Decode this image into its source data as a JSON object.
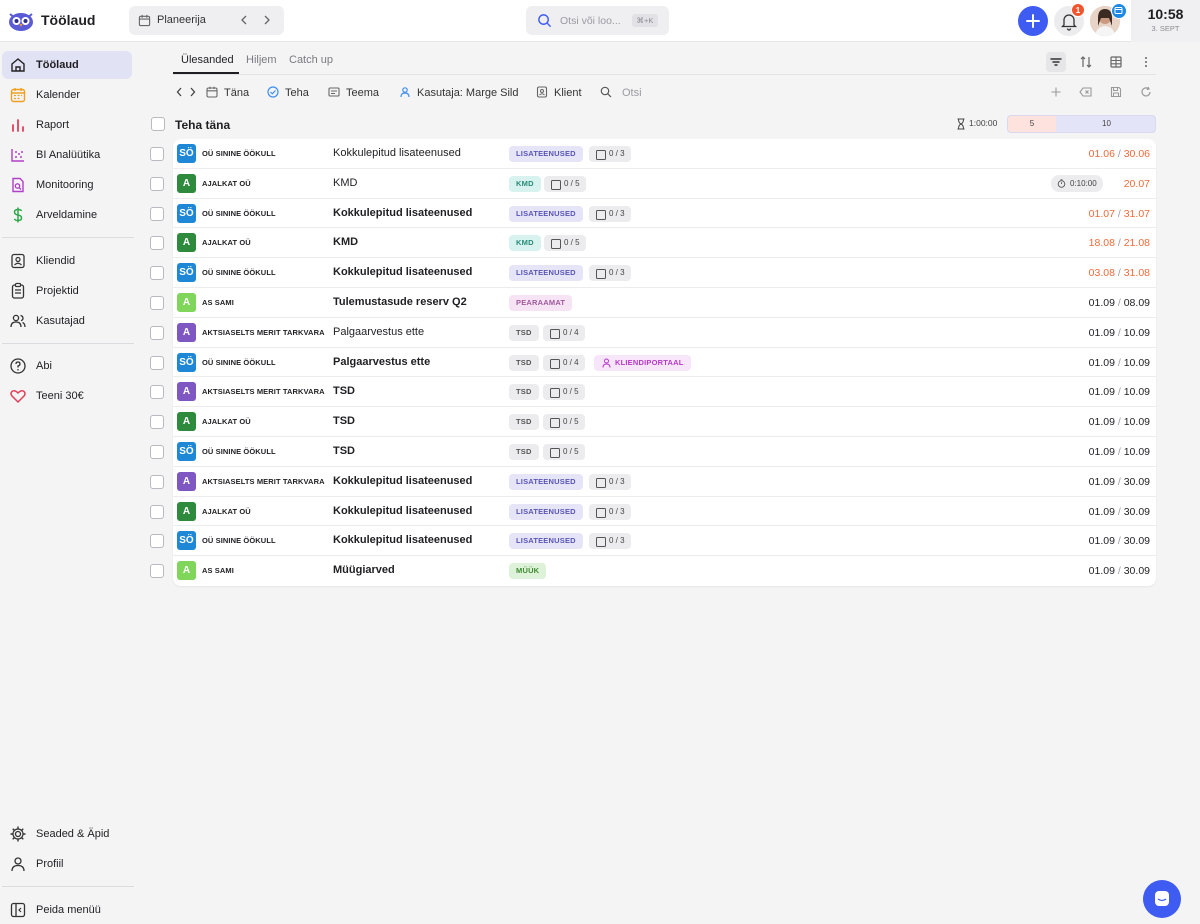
{
  "app": {
    "title": "Töölaud"
  },
  "topbar": {
    "planner_label": "Planeerija",
    "search_placeholder": "Otsi või loo...",
    "search_shortcut": "⌘+K",
    "notification_count": "1",
    "time": "10:58",
    "date": "3. SEPT"
  },
  "sidebar": {
    "items": [
      {
        "label": "Töölaud",
        "icon": "home-icon"
      },
      {
        "label": "Kalender",
        "icon": "calendar-icon"
      },
      {
        "label": "Raport",
        "icon": "bar-chart-icon"
      },
      {
        "label": "BI Analüütika",
        "icon": "scatter-chart-icon"
      },
      {
        "label": "Monitooring",
        "icon": "monitor-search-icon"
      },
      {
        "label": "Arveldamine",
        "icon": "dollar-icon"
      },
      {
        "label": "Kliendid",
        "icon": "contact-icon"
      },
      {
        "label": "Projektid",
        "icon": "clipboard-icon"
      },
      {
        "label": "Kasutajad",
        "icon": "users-icon"
      },
      {
        "label": "Abi",
        "icon": "help-icon"
      },
      {
        "label": "Teeni 30€",
        "icon": "heart-icon"
      },
      {
        "label": "Seaded & Äpid",
        "icon": "gear-icon"
      },
      {
        "label": "Profiil",
        "icon": "user-icon"
      },
      {
        "label": "Peida menüü",
        "icon": "sidebar-collapse-icon"
      }
    ]
  },
  "tabs": [
    {
      "label": "Ülesanded"
    },
    {
      "label": "Hiljem"
    },
    {
      "label": "Catch up"
    }
  ],
  "filters": {
    "date_label": "Täna",
    "status_label": "Teha",
    "topic_label": "Teema",
    "user_label": "Kasutaja: Marge Sild",
    "client_label": "Klient",
    "search_placeholder": "Otsi"
  },
  "section": {
    "title": "Teha täna",
    "time_total": "1:00:00",
    "capacity_low": "5",
    "capacity_high": "10"
  },
  "colors": {
    "accent": "#3e5bf2",
    "overdue": "#ef6a3a",
    "client_blue": "#1e88d6",
    "client_green": "#2e8b3e",
    "client_lightgreen": "#7fd65a",
    "client_purple": "#7e57c2"
  },
  "tasks": [
    {
      "avatar": "SÖ",
      "client": "OÜ SININE ÖÖKULL",
      "title": "Kokkulepitud lisateenused",
      "bold": false,
      "tag": "LISATEENUSED",
      "checklist": "0 / 3",
      "date_start": "01.06",
      "date_end": "30.06",
      "overdue": true
    },
    {
      "avatar": "A",
      "client": "AJALKAT OÜ",
      "title": "KMD",
      "bold": false,
      "tag": "KMD",
      "checklist": "0 / 5",
      "timer": "0:10:00",
      "date_start": "",
      "date_end": "20.07",
      "overdue": true
    },
    {
      "avatar": "SÖ",
      "client": "OÜ SININE ÖÖKULL",
      "title": "Kokkulepitud lisateenused",
      "bold": true,
      "tag": "LISATEENUSED",
      "checklist": "0 / 3",
      "date_start": "01.07",
      "date_end": "31.07",
      "overdue": true
    },
    {
      "avatar": "A",
      "client": "AJALKAT OÜ",
      "title": "KMD",
      "bold": true,
      "tag": "KMD",
      "checklist": "0 / 5",
      "date_start": "18.08",
      "date_end": "21.08",
      "overdue": true
    },
    {
      "avatar": "SÖ",
      "client": "OÜ SININE ÖÖKULL",
      "title": "Kokkulepitud lisateenused",
      "bold": true,
      "tag": "LISATEENUSED",
      "checklist": "0 / 3",
      "date_start": "03.08",
      "date_end": "31.08",
      "overdue": true
    },
    {
      "avatar": "A",
      "client": "AS SAMI",
      "title": "Tulemustasude reserv Q2",
      "bold": true,
      "tag": "PEARAAMAT",
      "date_start": "01.09",
      "date_end": "08.09",
      "overdue": false
    },
    {
      "avatar": "A",
      "client": "AKTSIASELTS MERIT TARKVARA",
      "title": "Palgaarvestus ette",
      "bold": false,
      "tag": "TSD",
      "checklist": "0 / 4",
      "date_start": "01.09",
      "date_end": "10.09",
      "overdue": false
    },
    {
      "avatar": "SÖ",
      "client": "OÜ SININE ÖÖKULL",
      "title": "Palgaarvestus ette",
      "bold": true,
      "tag": "TSD",
      "checklist": "0 / 4",
      "portal": "KLIENDIPORTAAL",
      "date_start": "01.09",
      "date_end": "10.09",
      "overdue": false
    },
    {
      "avatar": "A",
      "client": "AKTSIASELTS MERIT TARKVARA",
      "title": "TSD",
      "bold": true,
      "tag": "TSD",
      "checklist": "0 / 5",
      "date_start": "01.09",
      "date_end": "10.09",
      "overdue": false
    },
    {
      "avatar": "A",
      "client": "AJALKAT OÜ",
      "title": "TSD",
      "bold": true,
      "tag": "TSD",
      "checklist": "0 / 5",
      "date_start": "01.09",
      "date_end": "10.09",
      "overdue": false
    },
    {
      "avatar": "SÖ",
      "client": "OÜ SININE ÖÖKULL",
      "title": "TSD",
      "bold": true,
      "tag": "TSD",
      "checklist": "0 / 5",
      "date_start": "01.09",
      "date_end": "10.09",
      "overdue": false
    },
    {
      "avatar": "A",
      "client": "AKTSIASELTS MERIT TARKVARA",
      "title": "Kokkulepitud lisateenused",
      "bold": true,
      "tag": "LISATEENUSED",
      "checklist": "0 / 3",
      "date_start": "01.09",
      "date_end": "30.09",
      "overdue": false
    },
    {
      "avatar": "A",
      "client": "AJALKAT OÜ",
      "title": "Kokkulepitud lisateenused",
      "bold": true,
      "tag": "LISATEENUSED",
      "checklist": "0 / 3",
      "date_start": "01.09",
      "date_end": "30.09",
      "overdue": false
    },
    {
      "avatar": "SÖ",
      "client": "OÜ SININE ÖÖKULL",
      "title": "Kokkulepitud lisateenused",
      "bold": true,
      "tag": "LISATEENUSED",
      "checklist": "0 / 3",
      "date_start": "01.09",
      "date_end": "30.09",
      "overdue": false
    },
    {
      "avatar": "A",
      "client": "AS SAMI",
      "title": "Müügiarved",
      "bold": true,
      "tag": "MÜÜK",
      "date_start": "01.09",
      "date_end": "30.09",
      "overdue": false
    }
  ]
}
